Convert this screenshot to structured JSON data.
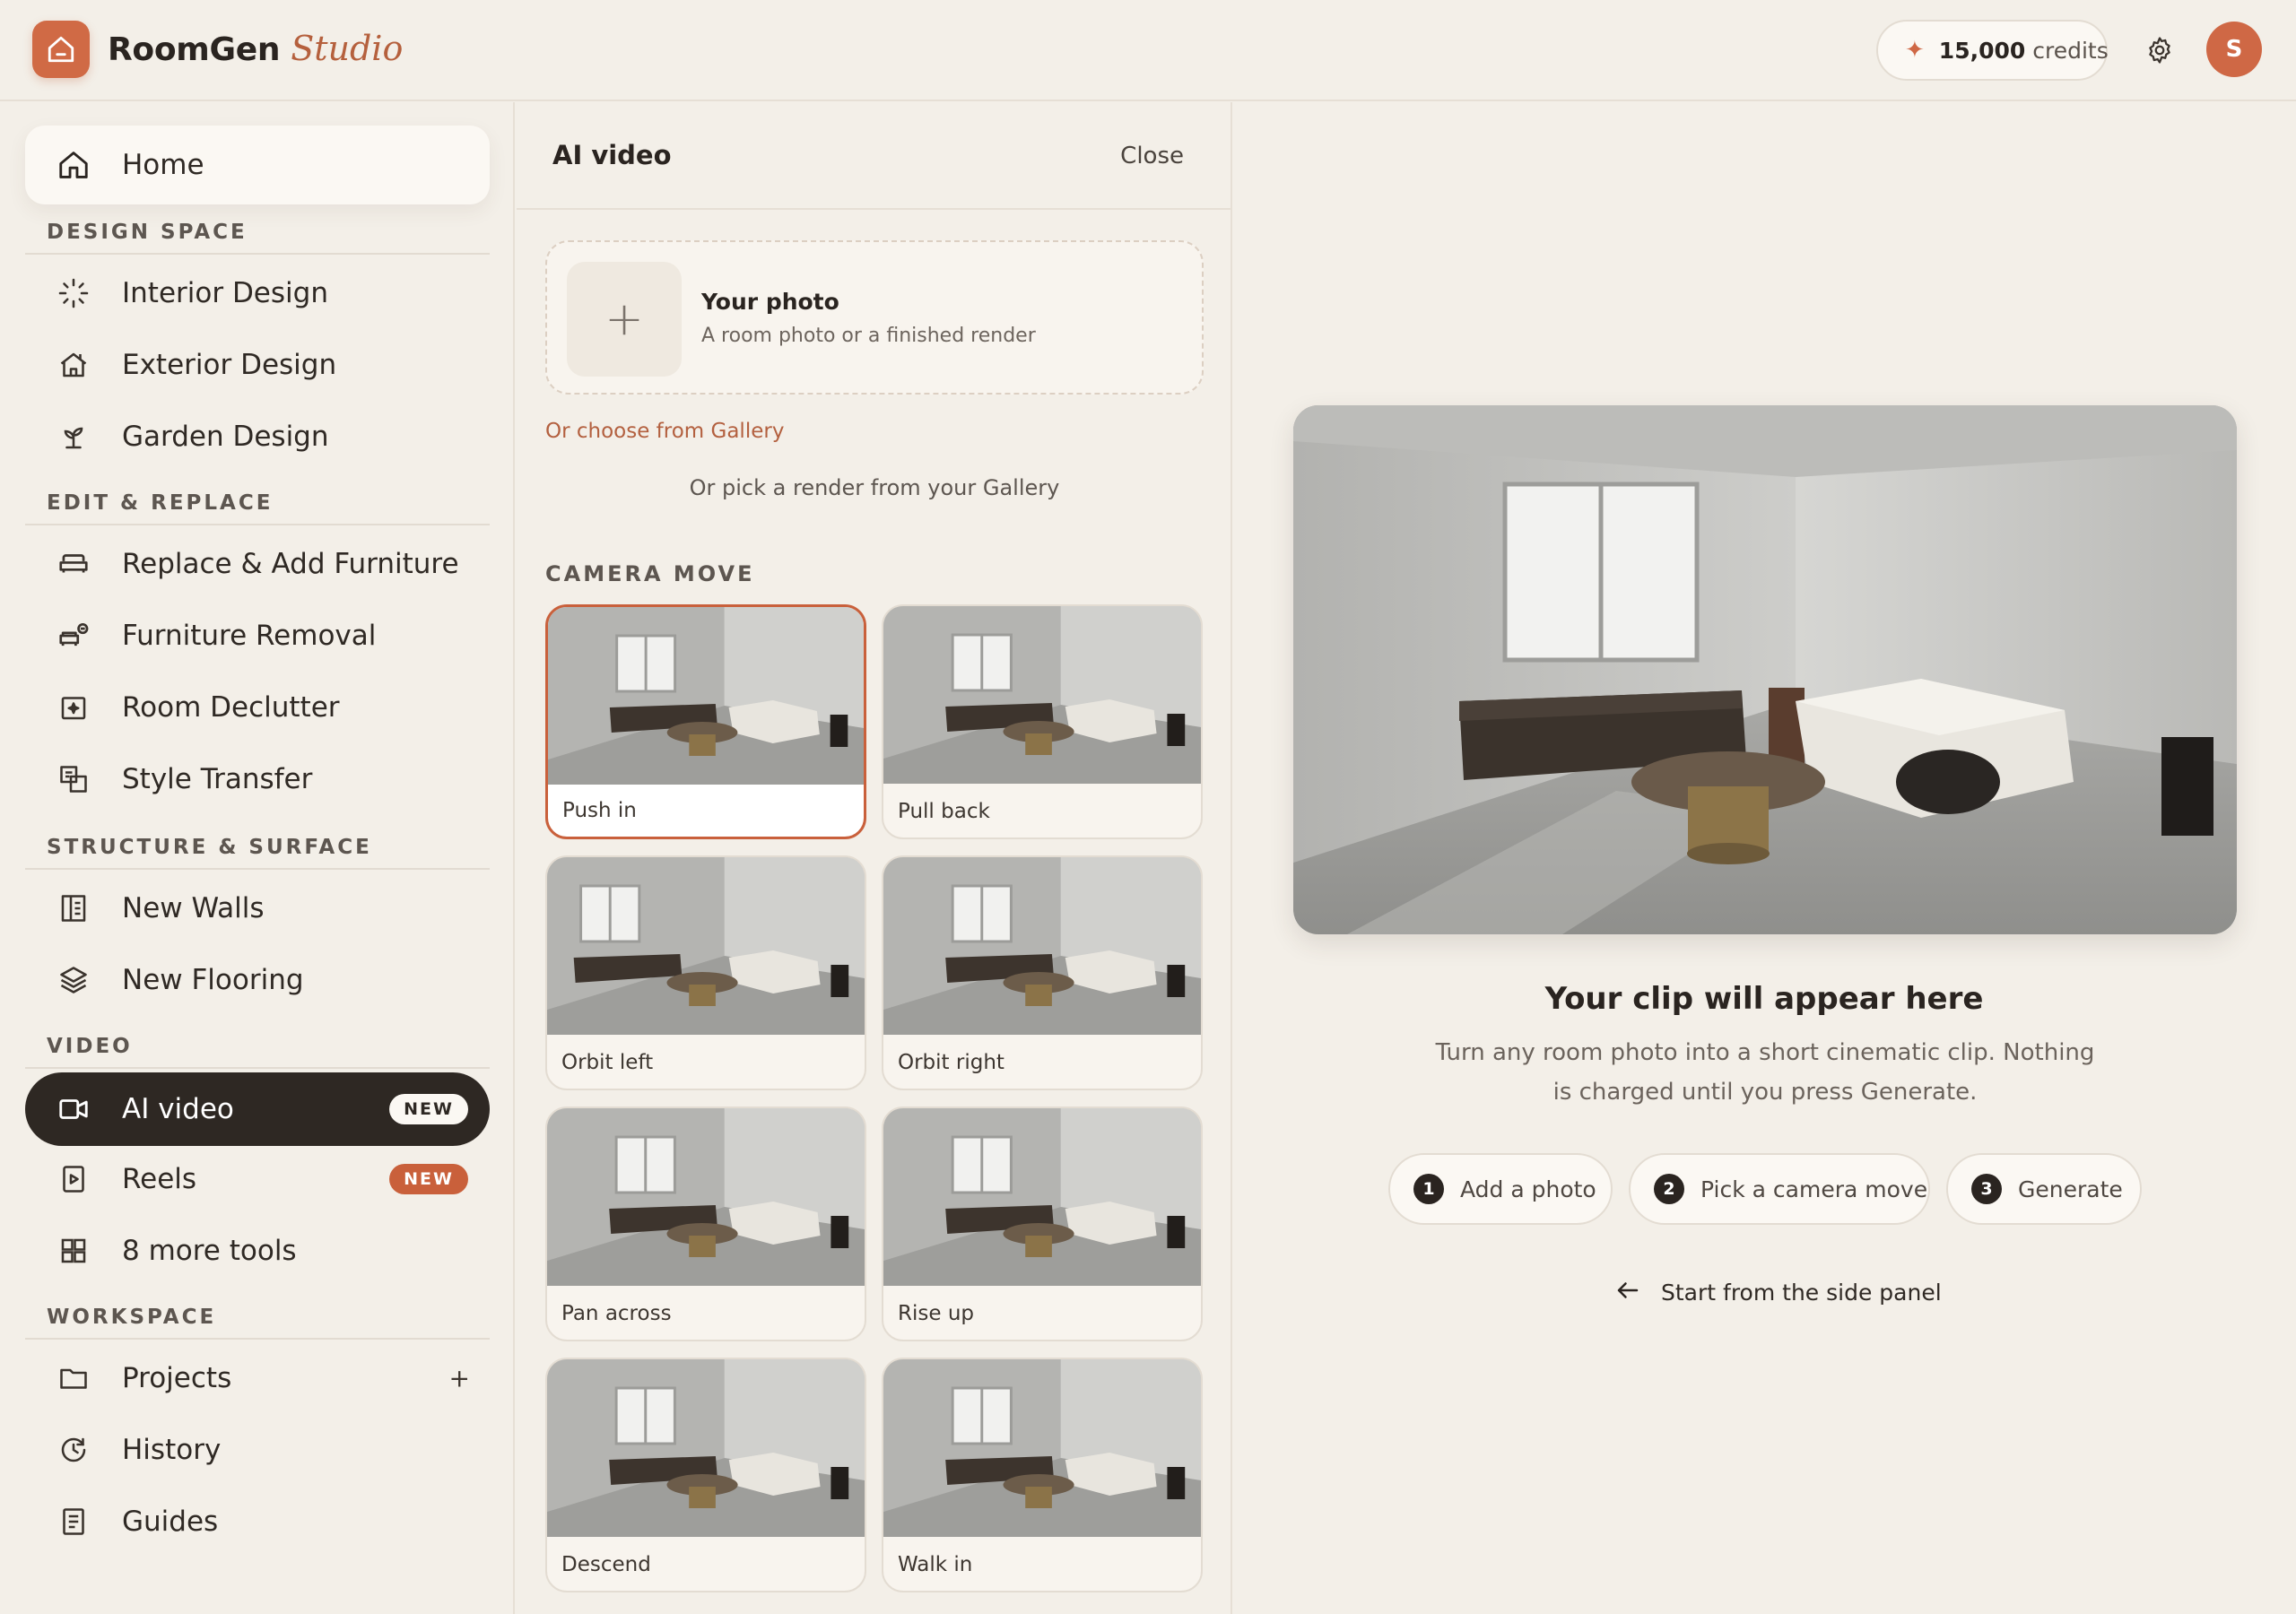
{
  "app": {
    "name": "RoomGen",
    "name_suffix": "Studio",
    "credits_amount": "15,000",
    "credits_unit": "credits",
    "avatar_initial": "S",
    "accent_color": "#cf6845"
  },
  "sidebar": {
    "home_label": "Home",
    "sections": {
      "design_space": "DESIGN SPACE",
      "edit_replace": "EDIT & REPLACE",
      "structure_surface": "STRUCTURE & SURFACE",
      "video": "VIDEO",
      "workspace": "WORKSPACE"
    },
    "items": {
      "interior_design": "Interior Design",
      "exterior_design": "Exterior Design",
      "garden_design": "Garden Design",
      "replace_add_furniture": "Replace & Add Furniture",
      "furniture_removal": "Furniture Removal",
      "room_declutter": "Room Declutter",
      "style_transfer": "Style Transfer",
      "new_walls": "New Walls",
      "new_flooring": "New Flooring",
      "ai_video": "AI video",
      "reels": "Reels",
      "more_tools": "8 more tools",
      "projects": "Projects",
      "history": "History",
      "guides": "Guides"
    },
    "badges": {
      "ai_video": "NEW",
      "reels": "NEW"
    },
    "projects_add": "+"
  },
  "panel": {
    "title": "AI video",
    "close_label": "Close",
    "upload_title": "Your photo",
    "upload_subtitle": "A room photo or a finished render",
    "gallery_link": "Or choose from Gallery",
    "gallery_hint": "Or pick a render from your Gallery",
    "camera_section": "CAMERA MOVE",
    "camera_moves": [
      {
        "label": "Push in",
        "selected": true
      },
      {
        "label": "Pull back",
        "selected": false
      },
      {
        "label": "Orbit left",
        "selected": false
      },
      {
        "label": "Orbit right",
        "selected": false
      },
      {
        "label": "Pan across",
        "selected": false
      },
      {
        "label": "Rise up",
        "selected": false
      },
      {
        "label": "Descend",
        "selected": false
      },
      {
        "label": "Walk in",
        "selected": false
      }
    ]
  },
  "main": {
    "empty_title": "Your clip will appear here",
    "empty_description": "Turn any room photo into a short cinematic clip. Nothing is charged until you press Generate.",
    "steps": [
      {
        "num": "1",
        "label": "Add a photo"
      },
      {
        "num": "2",
        "label": "Pick a camera move"
      },
      {
        "num": "3",
        "label": "Generate"
      }
    ],
    "side_hint": "Start from the side panel"
  }
}
